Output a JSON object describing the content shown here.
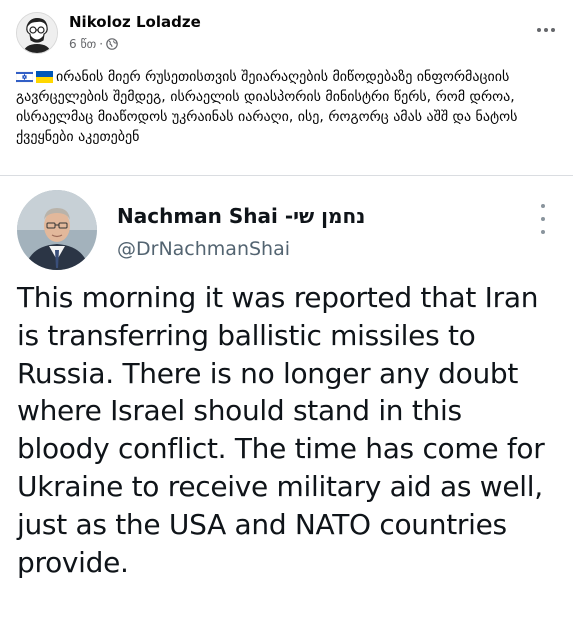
{
  "post": {
    "author": "Nikoloz Loladze",
    "time": "6 წთ",
    "separator": "·",
    "audience_icon": "globe-icon",
    "more_icon": "more-horizontal-icon",
    "flags": [
      "israel-flag",
      "ukraine-flag"
    ],
    "text": "ირანის მიერ რუსეთისთვის შეიარაღების მიწოდებაზე ინფორმაციის გავრცელების შემდეგ, ისრაელის დიასპორის მინისტრი წერს, რომ დროა, ისრაელმაც მიაწოდოს უკრაინას იარაღი, ისე, როგორც ამას აშშ და ნატოს ქვეყნები აკეთებენ"
  },
  "tweet": {
    "name": "Nachman Shai -נחמן שי",
    "handle": "@DrNachmanShai",
    "more_icon": "more-vertical-icon",
    "text": "This morning it was reported that Iran is transferring ballistic missiles to Russia. There is no longer any doubt where Israel should stand in this bloody conflict. The time has come for Ukraine to receive military aid as well, just as the USA and NATO countries provide."
  },
  "colors": {
    "secondary_text": "#65676b",
    "tweet_text": "#0f1419",
    "tweet_handle": "#536471",
    "ukraine_blue": "#0057b7",
    "ukraine_yellow": "#ffd700",
    "israel_blue": "#0038b8"
  }
}
